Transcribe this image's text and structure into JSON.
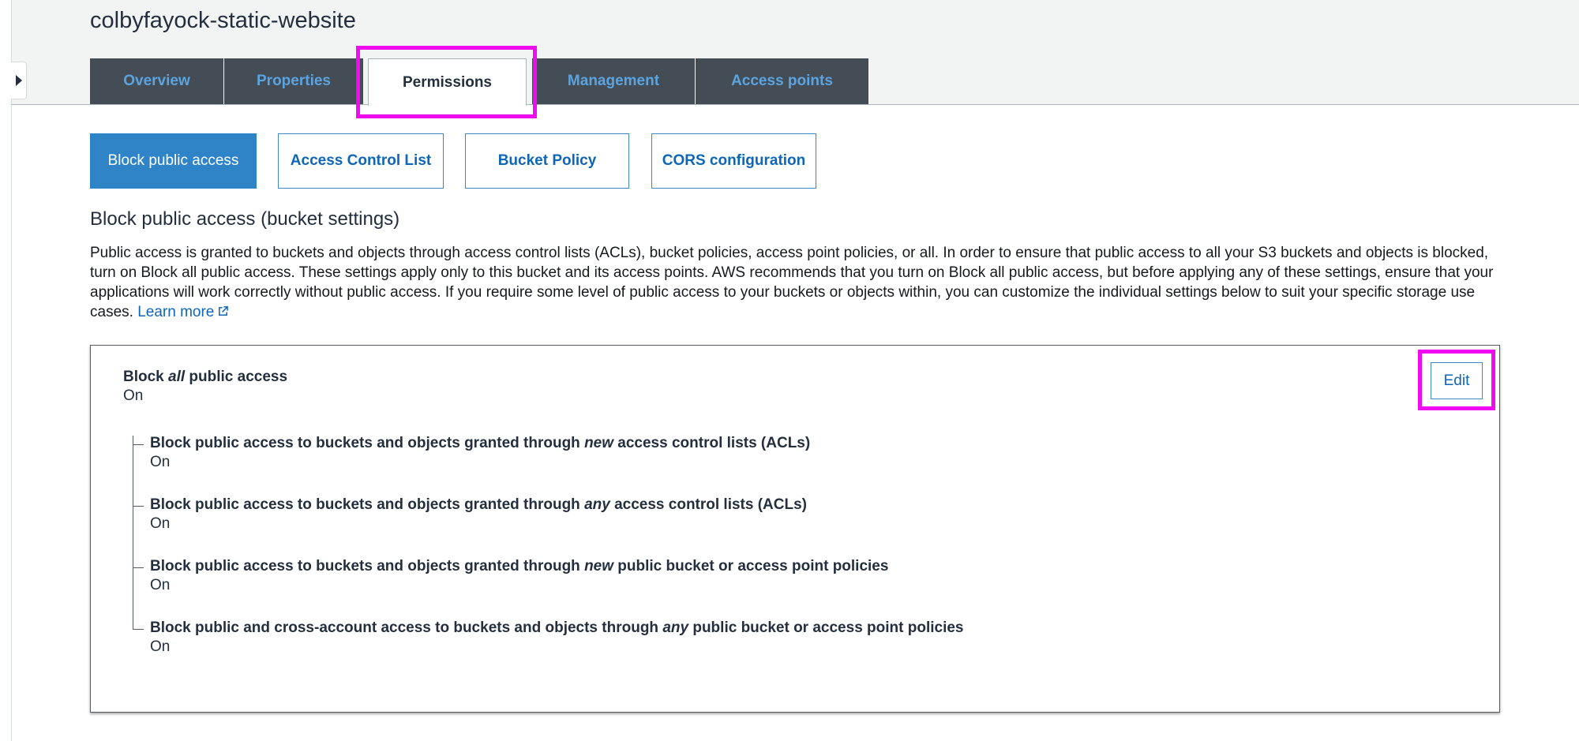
{
  "bucket": {
    "name": "colbyfayock-static-website"
  },
  "tabs": [
    {
      "label": "Overview",
      "active": false
    },
    {
      "label": "Properties",
      "active": false
    },
    {
      "label": "Permissions",
      "active": true
    },
    {
      "label": "Management",
      "active": false
    },
    {
      "label": "Access points",
      "active": false
    }
  ],
  "subtabs": [
    {
      "label": "Block public access",
      "active": true
    },
    {
      "label": "Access Control List",
      "active": false
    },
    {
      "label": "Bucket Policy",
      "active": false
    },
    {
      "label": "CORS configuration",
      "active": false
    }
  ],
  "section": {
    "title": "Block public access (bucket settings)",
    "description": "Public access is granted to buckets and objects through access control lists (ACLs), bucket policies, access point policies, or all. In order to ensure that public access to all your S3 buckets and objects is blocked, turn on Block all public access. These settings apply only to this bucket and its access points. AWS recommends that you turn on Block all public access, but before applying any of these settings, ensure that your applications will work correctly without public access. If you require some level of public access to your buckets or objects within, you can customize the individual settings below to suit your specific storage use cases.",
    "learn_more": "Learn more"
  },
  "panel": {
    "main": {
      "title_prefix": "Block ",
      "title_emphasis": "all",
      "title_suffix": " public access",
      "value": "On"
    },
    "edit_label": "Edit",
    "settings": [
      {
        "prefix": "Block public access to buckets and objects granted through ",
        "emphasis": "new",
        "suffix": " access control lists (ACLs)",
        "value": "On"
      },
      {
        "prefix": "Block public access to buckets and objects granted through ",
        "emphasis": "any",
        "suffix": " access control lists (ACLs)",
        "value": "On"
      },
      {
        "prefix": "Block public access to buckets and objects granted through ",
        "emphasis": "new",
        "suffix": " public bucket or access point policies",
        "value": "On"
      },
      {
        "prefix": "Block public and cross-account access to buckets and objects through ",
        "emphasis": "any",
        "suffix": " public bucket or access point policies",
        "value": "On"
      }
    ]
  },
  "colors": {
    "highlight": "#f00bf0",
    "link": "#0e66b8",
    "active_subtab": "#2f84c8",
    "tab_bg": "#444c56"
  },
  "icons": {
    "sidebar_toggle": "caret-right-icon",
    "external_link": "external-link-icon"
  }
}
